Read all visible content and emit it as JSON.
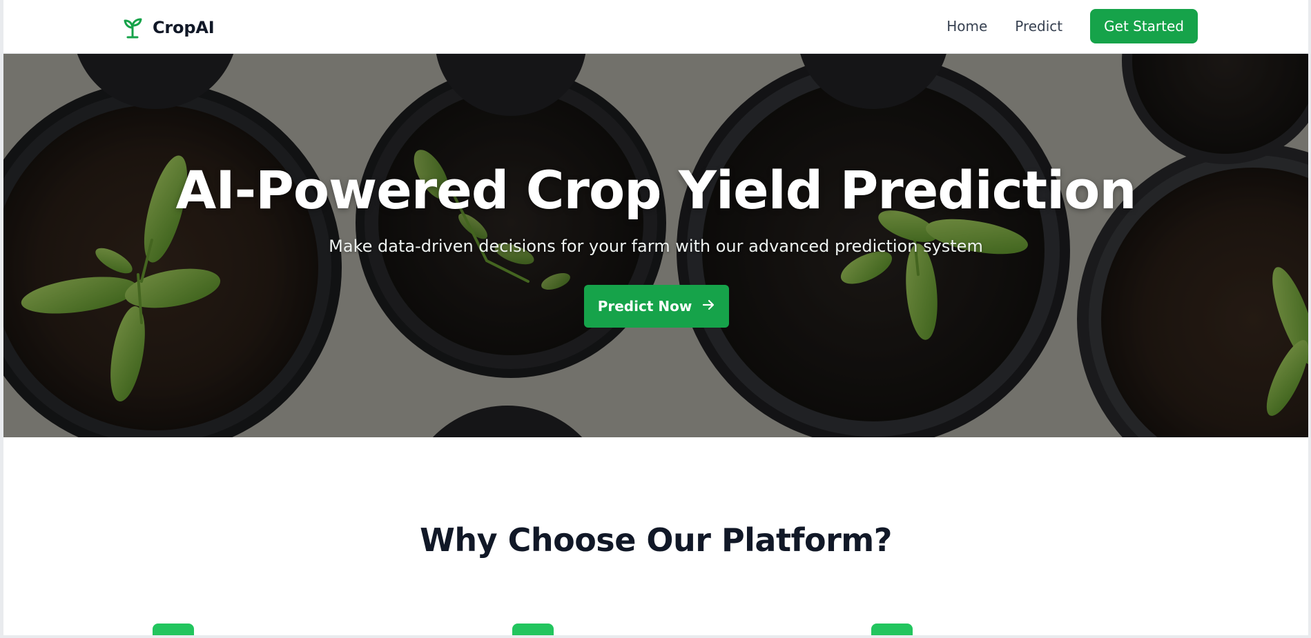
{
  "header": {
    "brand_name": "CropAI",
    "brand_icon": "sprout-icon",
    "nav": {
      "home": "Home",
      "predict": "Predict",
      "get_started": "Get Started"
    }
  },
  "hero": {
    "title": "AI-Powered Crop Yield Prediction",
    "subtitle": "Make data-driven decisions for your farm with our advanced prediction system",
    "cta_label": "Predict Now",
    "cta_icon": "arrow-right-icon",
    "background": "seedling-pots-photo"
  },
  "features": {
    "title": "Why Choose Our Platform?",
    "icons": [
      "feature-icon",
      "feature-icon",
      "feature-icon"
    ]
  },
  "colors": {
    "accent": "#16a34a",
    "accent_light": "#22c55e",
    "heading": "#111827",
    "text": "#374151"
  }
}
